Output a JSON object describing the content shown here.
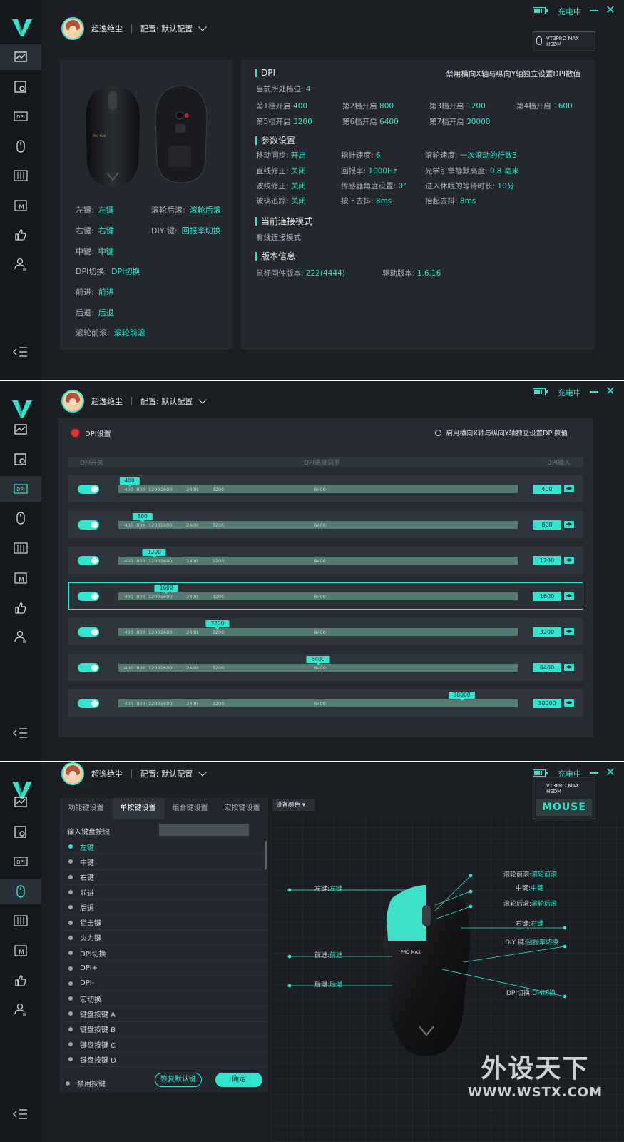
{
  "app": {
    "username": "超逸绝尘",
    "config_label": "配置: 默认配置",
    "charging": "充电中",
    "device_name": "VT3PRO MAX HSDM"
  },
  "colors": {
    "accent": "#2ee6d0",
    "bg": "#1b1f24",
    "sidebar": "#14171b",
    "alert": "#e0333a"
  },
  "sidebar_icons": [
    "performance-icon",
    "device-settings-icon",
    "dpi-icon",
    "mouse-icon",
    "equalizer-icon",
    "macro-icon",
    "thumbs-up-icon",
    "user-profile-icon"
  ],
  "overview": {
    "buttons": [
      {
        "k": "左键:",
        "v": "左键"
      },
      {
        "k": "滚轮后滚:",
        "v": "滚轮后滚"
      },
      {
        "k": "右键:",
        "v": "右键"
      },
      {
        "k": "DIY 键:",
        "v": "回报率切换"
      },
      {
        "k": "中键:",
        "v": "中键"
      },
      {
        "k": "DPI切换:",
        "v": "DPI切换"
      },
      {
        "k": "前进:",
        "v": "前进"
      },
      {
        "k": "后退:",
        "v": "后退"
      },
      {
        "k": "滚轮前滚:",
        "v": "滚轮前滚"
      }
    ],
    "dpi_title": "DPI",
    "dpi_note": "禁用横向X轴与纵向Y轴独立设置DPI数值",
    "current_level_label": "当前所处档位:",
    "current_level": "4",
    "levels": [
      {
        "k": "第1档开启",
        "v": "400"
      },
      {
        "k": "第2档开启",
        "v": "800"
      },
      {
        "k": "第3档开启",
        "v": "1200"
      },
      {
        "k": "第4档开启",
        "v": "1600"
      },
      {
        "k": "第5档开启",
        "v": "3200"
      },
      {
        "k": "第6档开启",
        "v": "6400"
      },
      {
        "k": "第7档开启",
        "v": "30000"
      }
    ],
    "params_title": "参数设置",
    "params": [
      {
        "k": "移动同步:",
        "v": "开启"
      },
      {
        "k": "指针速度:",
        "v": "6"
      },
      {
        "k": "滚轮速度:",
        "v": "一次滚动的行数3"
      },
      {
        "k": "直线修正:",
        "v": "关闭"
      },
      {
        "k": "回报率:",
        "v": "1000Hz"
      },
      {
        "k": "光学引擎静默高度:",
        "v": "0.8 毫米"
      },
      {
        "k": "波纹修正:",
        "v": "关闭"
      },
      {
        "k": "传感器角度设置:",
        "v": "0°"
      },
      {
        "k": "进入休眠的等待时长:",
        "v": "10分"
      },
      {
        "k": "玻璃追踪:",
        "v": "关闭"
      },
      {
        "k": "按下去抖:",
        "v": "8ms"
      },
      {
        "k": "抬起去抖:",
        "v": "8ms"
      }
    ],
    "conn_title": "当前连接模式",
    "conn_mode": "有线连接模式",
    "version_title": "版本信息",
    "firmware_label": "鼠标固件版本:",
    "firmware": "222(4444)",
    "driver_label": "驱动版本:",
    "driver": "1.6.16"
  },
  "dpi_page": {
    "title": "DPI设置",
    "option": "启用横向X轴与纵向Y轴独立设置DPI数值",
    "col_switch": "DPI开关",
    "col_adjust": "DPI速度调节",
    "col_input": "DPI输入",
    "ticks": [
      "400",
      "800",
      "1200",
      "1600",
      "2400",
      "3200",
      "6400"
    ],
    "rows": [
      {
        "value": "400",
        "enabled": true,
        "pos": 0.028
      },
      {
        "value": "800",
        "enabled": true,
        "pos": 0.06
      },
      {
        "value": "1200",
        "enabled": true,
        "pos": 0.09
      },
      {
        "value": "1600",
        "enabled": true,
        "pos": 0.12
      },
      {
        "value": "3200",
        "enabled": true,
        "pos": 0.248
      },
      {
        "value": "6400",
        "enabled": true,
        "pos": 0.5
      },
      {
        "value": "30000",
        "enabled": true,
        "pos": 0.86
      }
    ],
    "selected_row": 3
  },
  "key_page": {
    "tabs": [
      "功能键设置",
      "单按键设置",
      "组合键设置",
      "宏按键设置"
    ],
    "active_tab": 1,
    "input_label": "输入键盘按键",
    "items": [
      "左键",
      "中键",
      "右键",
      "前进",
      "后退",
      "狙击键",
      "火力键",
      "DPI切换",
      "DPI+",
      "DPI-",
      "宏切换",
      "键盘按键 A",
      "键盘按键 B",
      "键盘按键 C",
      "键盘按键 D"
    ],
    "active_item": 0,
    "disable_label": "禁用按键",
    "reset_button": "恢复默认键",
    "ok_button": "确定",
    "device_color": "设备颜色",
    "mouse_label": "MOUSE",
    "callouts": {
      "left": "左键:",
      "left_v": "左键",
      "forward": "前进:",
      "forward_v": "前进",
      "back": "后退:",
      "back_v": "后退",
      "scroll_fwd": "滚轮前滚:",
      "scroll_fwd_v": "滚轮前滚",
      "middle": "中键:",
      "middle_v": "中键",
      "scroll_back": "滚轮后滚:",
      "scroll_back_v": "滚轮后滚",
      "right": "右键:",
      "right_v": "右键",
      "diy": "DIY 键:",
      "diy_v": "回报率切换",
      "dpi_switch": "DPI切换:",
      "dpi_switch_v": "DPI切换"
    }
  },
  "watermark": {
    "big": "外设天下",
    "small": "WWW.WSTX.COM"
  }
}
